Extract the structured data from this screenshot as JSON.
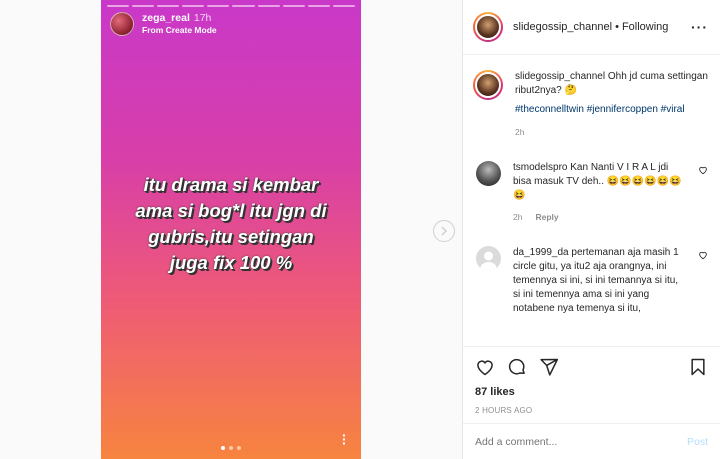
{
  "story": {
    "username": "zega_real",
    "time": "17h",
    "subtitle": "From Create Mode",
    "text": "itu drama si kembar\nama si bog*l itu jgn di\ngubris,itu setingan\njuga fix 100 %",
    "progress_segments": 10,
    "page_dots": 3,
    "active_dot": 0,
    "more_icon": "more-vertical-icon"
  },
  "post": {
    "header": {
      "username": "slidegossip_channel",
      "separator": "•",
      "follow_label": "Following",
      "menu_icon": "more-horizontal-icon"
    },
    "caption": {
      "username": "slidegossip_channel",
      "text": "Ohh jd cuma settingan ribut2nya? 🤔",
      "tags": "#theconnelltwin #jennifercoppen #viral",
      "time": "2h"
    },
    "comments": [
      {
        "username": "tsmodelspro",
        "text": "Kan Nanti V I R A L jdi bisa masuk TV deh.. 😆😆😆😆😆😆😆",
        "time": "2h",
        "reply_label": "Reply"
      },
      {
        "username": "da_1999_da",
        "text": "pertemanan aja masih 1 circle gitu, ya itu2 aja orangnya, ini temennya si ini, si ini temannya si itu, si ini temennya ama si ini yang notabene nya temenya si itu,"
      }
    ],
    "likes": "87 likes",
    "posted": "2 HOURS AGO",
    "add_comment_placeholder": "Add a comment...",
    "post_label": "Post"
  },
  "colors": {
    "link": "#00376b",
    "muted": "#8e8e8e",
    "post_disabled": "#b2dffc"
  }
}
